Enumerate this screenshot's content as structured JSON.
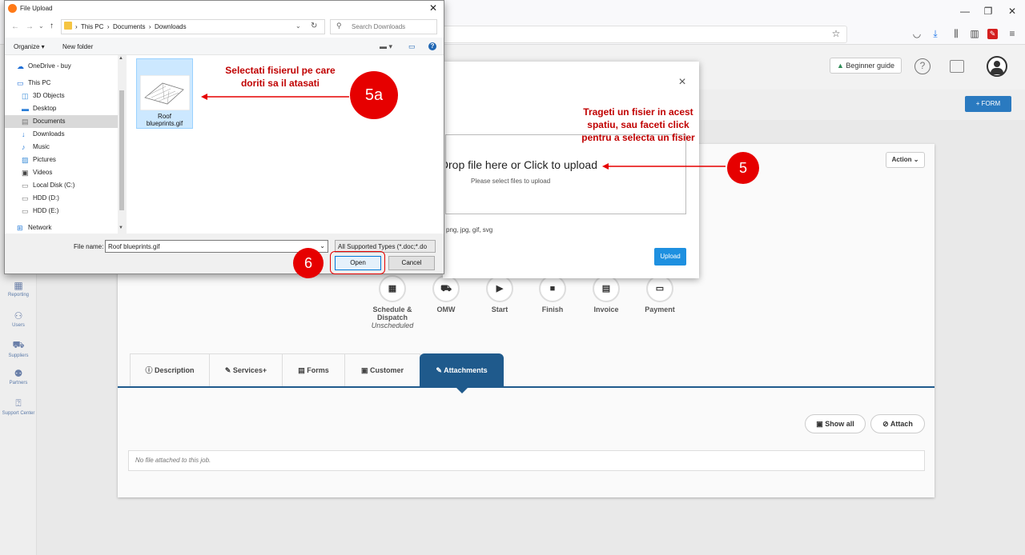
{
  "browser": {
    "window_controls": [
      "—",
      "❐",
      "✕"
    ],
    "toolbar_icons": [
      "star-icon",
      "pocket-icon",
      "download-icon",
      "library-icon",
      "sidebar-icon",
      "extension-icon",
      "menu-icon"
    ]
  },
  "app": {
    "header": {
      "beginner_guide": "Beginner guide",
      "help_icon": "?",
      "form_button": "+ FORM"
    },
    "sidebar": [
      {
        "label": "Reporting",
        "icon": "reporting-icon"
      },
      {
        "label": "Users",
        "icon": "users-icon"
      },
      {
        "label": "Suppliers",
        "icon": "suppliers-icon"
      },
      {
        "label": "Partners",
        "icon": "partners-icon"
      },
      {
        "label": "Support Center",
        "icon": "support-icon"
      }
    ],
    "job": {
      "action_button": "Action",
      "steps": [
        {
          "label": "Schedule & Dispatch",
          "sub": "Unscheduled",
          "glyph": "▦"
        },
        {
          "label": "OMW",
          "sub": "",
          "glyph": "⛟"
        },
        {
          "label": "Start",
          "sub": "",
          "glyph": "▶"
        },
        {
          "label": "Finish",
          "sub": "",
          "glyph": "■"
        },
        {
          "label": "Invoice",
          "sub": "",
          "glyph": "▤"
        },
        {
          "label": "Payment",
          "sub": "",
          "glyph": "▭"
        }
      ],
      "tabs": [
        {
          "label": "ⓘ Description"
        },
        {
          "label": "✎ Services+"
        },
        {
          "label": "▤ Forms"
        },
        {
          "label": "▣ Customer"
        },
        {
          "label": "✎ Attachments",
          "active": true
        }
      ],
      "show_all": "Show all",
      "attach": "Attach",
      "no_files": "No file attached to this job."
    },
    "upload_modal": {
      "close": "×",
      "drop_title": "Drop file here or Click to upload",
      "drop_sub": "Please select files to upload",
      "allowed": "png, jpg, gif, svg",
      "upload_button": "Upload"
    }
  },
  "file_dialog": {
    "title": "File Upload",
    "path": [
      "This PC",
      "Documents",
      "Downloads"
    ],
    "search_placeholder": "Search Downloads",
    "organize": "Organize ▾",
    "new_folder": "New folder",
    "tree": [
      {
        "label": "OneDrive - buy",
        "icon": "☁",
        "indent": 0
      },
      {
        "label": "This PC",
        "icon": "▭",
        "indent": 0
      },
      {
        "label": "3D Objects",
        "icon": "◫",
        "indent": 1
      },
      {
        "label": "Desktop",
        "icon": "▬",
        "indent": 1
      },
      {
        "label": "Documents",
        "icon": "▤",
        "indent": 1,
        "selected": true
      },
      {
        "label": "Downloads",
        "icon": "↓",
        "indent": 1
      },
      {
        "label": "Music",
        "icon": "♪",
        "indent": 1
      },
      {
        "label": "Pictures",
        "icon": "▨",
        "indent": 1
      },
      {
        "label": "Videos",
        "icon": "▣",
        "indent": 1
      },
      {
        "label": "Local Disk (C:)",
        "icon": "▭",
        "indent": 1
      },
      {
        "label": "HDD (D:)",
        "icon": "▭",
        "indent": 1
      },
      {
        "label": "HDD (E:)",
        "icon": "▭",
        "indent": 1
      },
      {
        "label": "Network",
        "icon": "⊞",
        "indent": 0
      }
    ],
    "file": {
      "name_line1": "Roof",
      "name_line2": "blueprints.gif"
    },
    "filename_label": "File name:",
    "filename_value": "Roof blueprints.gif",
    "filetype": "All Supported Types (*.doc;*.do",
    "open": "Open",
    "cancel": "Cancel"
  },
  "annotations": {
    "step_5a": "5a",
    "step_5": "5",
    "step_6": "6",
    "note_5a": [
      "Selectati fisierul pe care",
      "doriti sa il atasati"
    ],
    "note_5": [
      "Trageti un fisier in acest",
      "spatiu, sau faceti click",
      "pentru a  selecta un fisier"
    ],
    "color": "#e60000"
  }
}
